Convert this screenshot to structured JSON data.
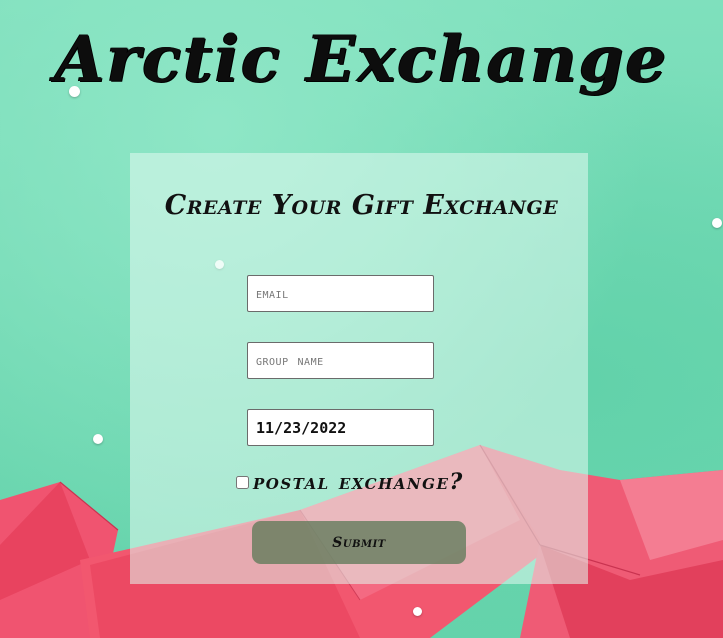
{
  "site": {
    "title": "Arctic Exchange"
  },
  "form": {
    "heading": "Create Your Gift Exchange",
    "email": {
      "placeholder": "email",
      "value": ""
    },
    "group_name": {
      "placeholder": "group name",
      "value": ""
    },
    "date": {
      "value": "11/23/2022"
    },
    "postal_exchange": {
      "label": "postal exchange?",
      "checked": false
    },
    "submit_label": "Submit"
  },
  "colors": {
    "background_mint": "#77dbb7",
    "envelope_red": "#ef4f6b",
    "panel": "#e1faf0",
    "submit_button": "#5a7855",
    "text": "#111111"
  }
}
